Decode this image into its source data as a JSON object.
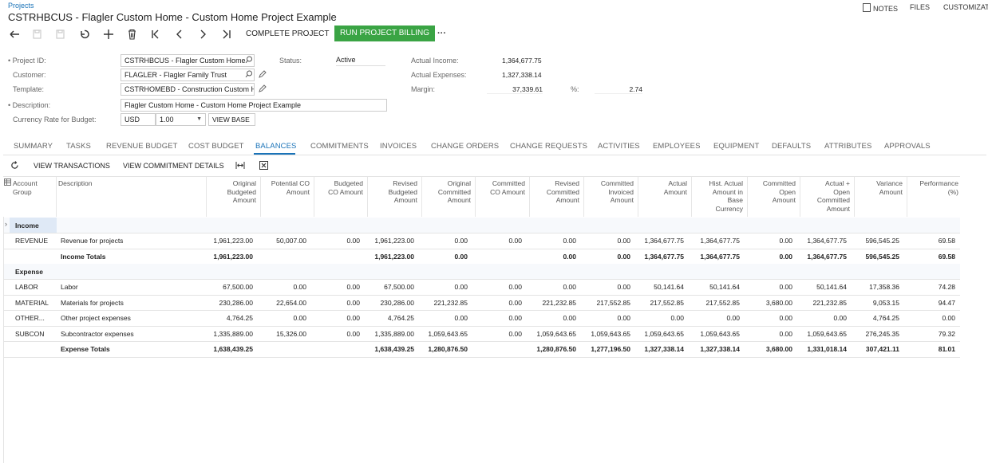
{
  "breadcrumb": "Projects",
  "page_title": "CSTRHBCUS - Flagler Custom Home - Custom Home Project Example",
  "top_links": {
    "notes": "NOTES",
    "files": "FILES",
    "customization": "CUSTOMIZATI"
  },
  "toolbar": {
    "complete_project": "COMPLETE PROJECT",
    "run_billing": "RUN PROJECT BILLING",
    "more": "···",
    "icons": [
      "back-icon",
      "save-icon",
      "save-close-icon",
      "undo-icon",
      "add-icon",
      "delete-icon",
      "first-icon",
      "prev-icon",
      "next-icon",
      "last-icon"
    ]
  },
  "form": {
    "project_id_label": "Project ID:",
    "project_id_value": "CSTRHBCUS - Flagler Custom Home",
    "customer_label": "Customer:",
    "customer_value": "FLAGLER - Flagler Family Trust",
    "template_label": "Template:",
    "template_value": "CSTRHOMEBD - Construction Custom H",
    "description_label": "Description:",
    "description_value": "Flagler Custom Home - Custom Home Project Example",
    "currency_label": "Currency Rate for Budget:",
    "currency_value": "USD",
    "rate_value": "1.00",
    "view_base": "VIEW BASE",
    "status_label": "Status:",
    "status_value": "Active",
    "actual_income_label": "Actual Income:",
    "actual_income_value": "1,364,677.75",
    "actual_expenses_label": "Actual Expenses:",
    "actual_expenses_value": "1,327,338.14",
    "margin_label": "Margin:",
    "margin_value": "37,339.61",
    "pct_label": "%:",
    "pct_value": "2.74"
  },
  "tabs": [
    "SUMMARY",
    "TASKS",
    "REVENUE BUDGET",
    "COST BUDGET",
    "BALANCES",
    "COMMITMENTS",
    "INVOICES",
    "CHANGE ORDERS",
    "CHANGE REQUESTS",
    "ACTIVITIES",
    "EMPLOYEES",
    "EQUIPMENT",
    "DEFAULTS",
    "ATTRIBUTES",
    "APPROVALS"
  ],
  "active_tab": "BALANCES",
  "grid_toolbar": {
    "view_transactions": "VIEW TRANSACTIONS",
    "view_commitment_details": "VIEW COMMITMENT DETAILS"
  },
  "table": {
    "headers": [
      [
        "Account",
        "Group"
      ],
      [
        "Description"
      ],
      [
        "Original",
        "Budgeted",
        "Amount"
      ],
      [
        "Potential CO",
        "Amount"
      ],
      [
        "Budgeted",
        "CO Amount"
      ],
      [
        "Revised",
        "Budgeted",
        "Amount"
      ],
      [
        "Original",
        "Committed",
        "Amount"
      ],
      [
        "Committed",
        "CO Amount"
      ],
      [
        "Revised",
        "Committed",
        "Amount"
      ],
      [
        "Committed",
        "Invoiced",
        "Amount"
      ],
      [
        "Actual",
        "Amount"
      ],
      [
        "Hist. Actual",
        "Amount in",
        "Base",
        "Currency"
      ],
      [
        "Committed",
        "Open",
        "Amount"
      ],
      [
        "Actual +",
        "Open",
        "Committed",
        "Amount"
      ],
      [
        "Variance",
        "Amount"
      ],
      [
        "Performance",
        "(%)"
      ]
    ],
    "rows": [
      {
        "type": "group",
        "cells": [
          "Income"
        ]
      },
      {
        "type": "data",
        "cells": [
          "REVENUE",
          "Revenue for projects",
          "1,961,223.00",
          "50,007.00",
          "0.00",
          "1,961,223.00",
          "0.00",
          "0.00",
          "0.00",
          "0.00",
          "1,364,677.75",
          "1,364,677.75",
          "0.00",
          "1,364,677.75",
          "596,545.25",
          "69.58"
        ]
      },
      {
        "type": "total",
        "cells": [
          "",
          "Income Totals",
          "1,961,223.00",
          "",
          "",
          "1,961,223.00",
          "0.00",
          "",
          "0.00",
          "0.00",
          "1,364,677.75",
          "1,364,677.75",
          "0.00",
          "1,364,677.75",
          "596,545.25",
          "69.58"
        ]
      },
      {
        "type": "group",
        "cells": [
          "Expense"
        ]
      },
      {
        "type": "data",
        "cells": [
          "LABOR",
          "Labor",
          "67,500.00",
          "0.00",
          "0.00",
          "67,500.00",
          "0.00",
          "0.00",
          "0.00",
          "0.00",
          "50,141.64",
          "50,141.64",
          "0.00",
          "50,141.64",
          "17,358.36",
          "74.28"
        ]
      },
      {
        "type": "data",
        "cells": [
          "MATERIAL",
          "Materials for projects",
          "230,286.00",
          "22,654.00",
          "0.00",
          "230,286.00",
          "221,232.85",
          "0.00",
          "221,232.85",
          "217,552.85",
          "217,552.85",
          "217,552.85",
          "3,680.00",
          "221,232.85",
          "9,053.15",
          "94.47"
        ]
      },
      {
        "type": "data",
        "cells": [
          "OTHER...",
          "Other project expenses",
          "4,764.25",
          "0.00",
          "0.00",
          "4,764.25",
          "0.00",
          "0.00",
          "0.00",
          "0.00",
          "0.00",
          "0.00",
          "0.00",
          "0.00",
          "4,764.25",
          "0.00"
        ]
      },
      {
        "type": "data",
        "cells": [
          "SUBCON",
          "Subcontractor expenses",
          "1,335,889.00",
          "15,326.00",
          "0.00",
          "1,335,889.00",
          "1,059,643.65",
          "0.00",
          "1,059,643.65",
          "1,059,643.65",
          "1,059,643.65",
          "1,059,643.65",
          "0.00",
          "1,059,643.65",
          "276,245.35",
          "79.32"
        ]
      },
      {
        "type": "total",
        "cells": [
          "",
          "Expense Totals",
          "1,638,439.25",
          "",
          "",
          "1,638,439.25",
          "1,280,876.50",
          "",
          "1,280,876.50",
          "1,277,196.50",
          "1,327,338.14",
          "1,327,338.14",
          "3,680.00",
          "1,331,018.14",
          "307,421.11",
          "81.01"
        ]
      }
    ]
  }
}
